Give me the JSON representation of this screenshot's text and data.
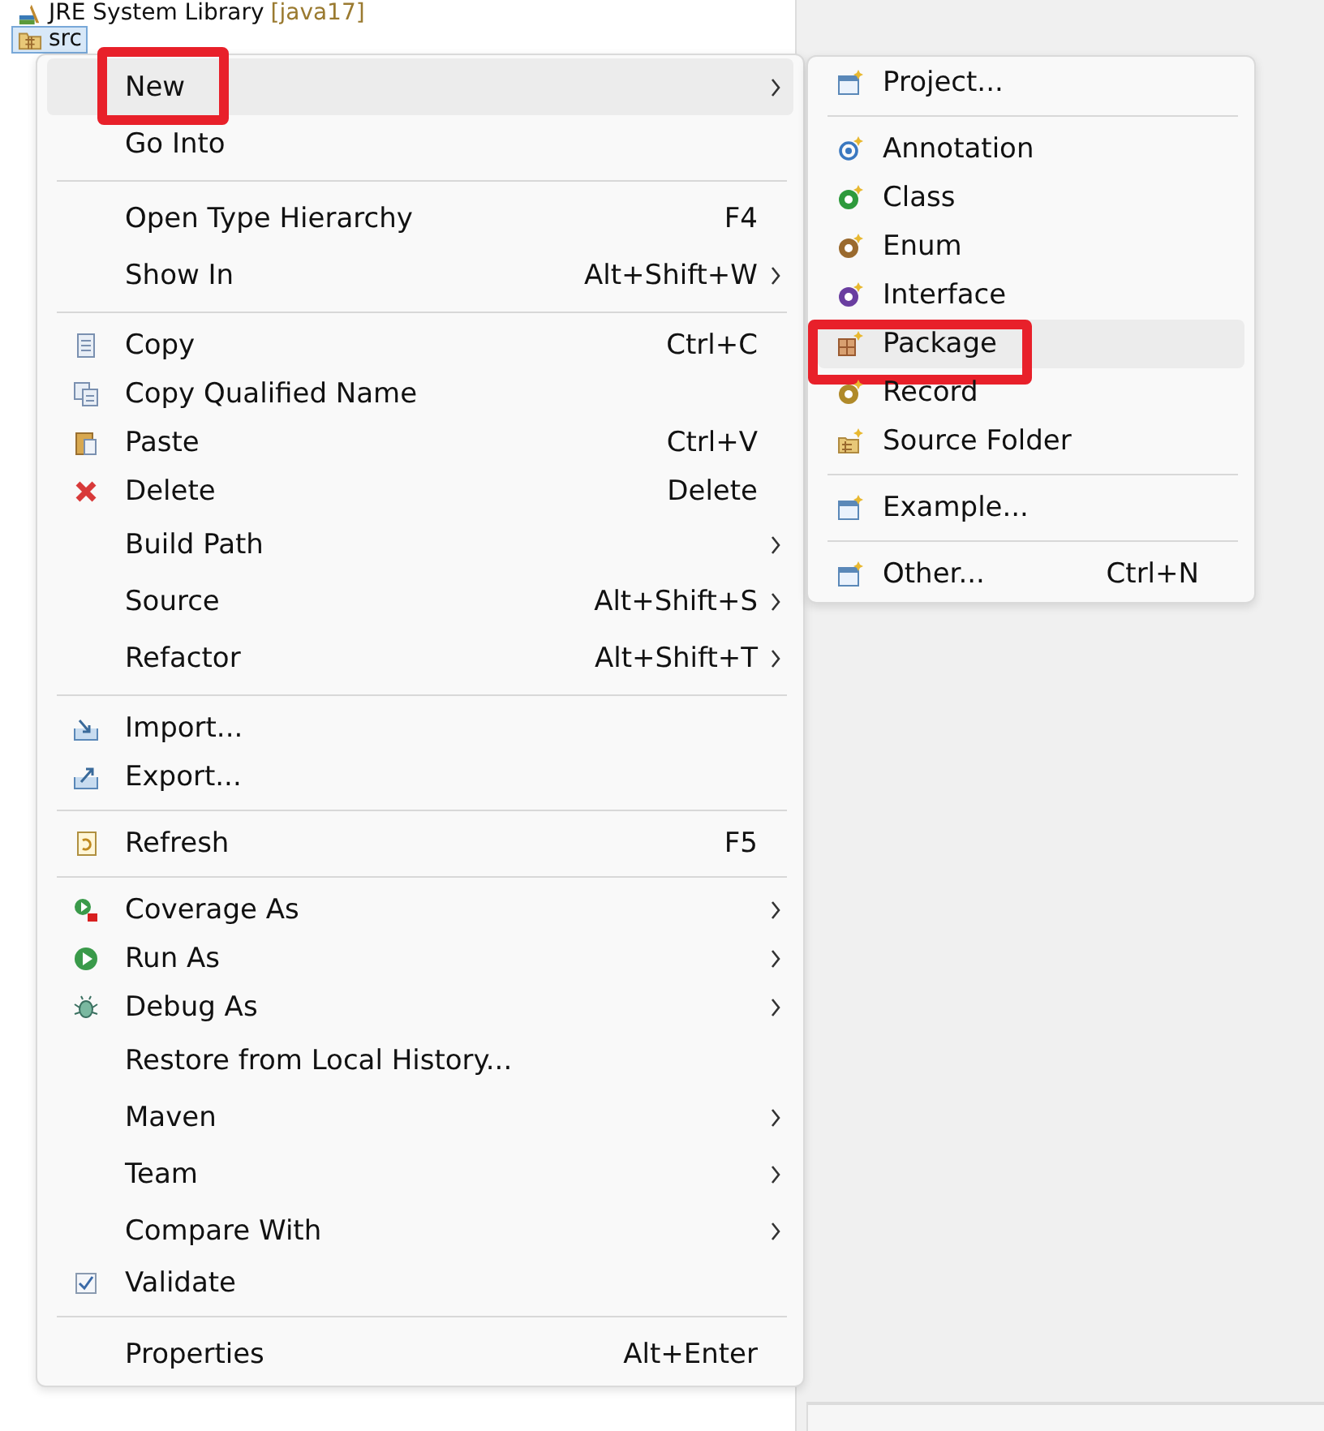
{
  "tree": [
    {
      "label": "JRE System Library",
      "decoration": "[java17]",
      "selected": false
    },
    {
      "label": "src",
      "selected": true
    }
  ],
  "context_menu": {
    "groups": [
      [
        {
          "label": "New",
          "submenu": true,
          "selected": true,
          "annotated": true
        },
        {
          "label": "Go Into",
          "submenu": false,
          "selected": false,
          "annotated": false
        }
      ],
      [
        {
          "label": "Open Type Hierarchy",
          "shortcut": "F4",
          "submenu": false,
          "selected": false,
          "annotated": false
        },
        {
          "label": "Show In",
          "shortcut": "Alt+Shift+W",
          "submenu": true,
          "selected": false,
          "annotated": false
        }
      ],
      [
        {
          "label": "Copy",
          "shortcut": "Ctrl+C",
          "submenu": false,
          "selected": false,
          "annotated": false
        },
        {
          "label": "Copy Qualified Name",
          "submenu": false,
          "selected": false,
          "annotated": false
        },
        {
          "label": "Paste",
          "shortcut": "Ctrl+V",
          "submenu": false,
          "selected": false,
          "annotated": false
        },
        {
          "label": "Delete",
          "shortcut": "Delete",
          "submenu": false,
          "selected": false,
          "annotated": false
        },
        {
          "label": "Build Path",
          "submenu": true,
          "selected": false,
          "annotated": false
        },
        {
          "label": "Source",
          "shortcut": "Alt+Shift+S",
          "submenu": true,
          "selected": false,
          "annotated": false
        },
        {
          "label": "Refactor",
          "shortcut": "Alt+Shift+T",
          "submenu": true,
          "selected": false,
          "annotated": false
        }
      ],
      [
        {
          "label": "Import...",
          "submenu": false,
          "selected": false,
          "annotated": false
        },
        {
          "label": "Export...",
          "submenu": false,
          "selected": false,
          "annotated": false
        }
      ],
      [
        {
          "label": "Refresh",
          "shortcut": "F5",
          "submenu": false,
          "selected": false,
          "annotated": false
        }
      ],
      [
        {
          "label": "Coverage As",
          "submenu": true,
          "selected": false,
          "annotated": false
        },
        {
          "label": "Run As",
          "submenu": true,
          "selected": false,
          "annotated": false
        },
        {
          "label": "Debug As",
          "submenu": true,
          "selected": false,
          "annotated": false
        },
        {
          "label": "Restore from Local History...",
          "submenu": false,
          "selected": false,
          "annotated": false
        },
        {
          "label": "Maven",
          "submenu": true,
          "selected": false,
          "annotated": false
        },
        {
          "label": "Team",
          "submenu": true,
          "selected": false,
          "annotated": false
        },
        {
          "label": "Compare With",
          "submenu": true,
          "selected": false,
          "annotated": false
        },
        {
          "label": "Validate",
          "submenu": false,
          "selected": false,
          "annotated": false
        }
      ],
      [
        {
          "label": "Properties",
          "shortcut": "Alt+Enter",
          "submenu": false,
          "selected": false,
          "annotated": false
        }
      ]
    ]
  },
  "submenu": {
    "groups": [
      [
        {
          "label": "Project...",
          "selected": false,
          "annotated": false
        }
      ],
      [
        {
          "label": "Annotation",
          "selected": false,
          "annotated": false
        },
        {
          "label": "Class",
          "selected": false,
          "annotated": false
        },
        {
          "label": "Enum",
          "selected": false,
          "annotated": false
        },
        {
          "label": "Interface",
          "selected": false,
          "annotated": false
        },
        {
          "label": "Package",
          "selected": true,
          "annotated": true
        },
        {
          "label": "Record",
          "selected": false,
          "annotated": false
        },
        {
          "label": "Source Folder",
          "selected": false,
          "annotated": false
        }
      ],
      [
        {
          "label": "Example...",
          "selected": false,
          "annotated": false
        }
      ],
      [
        {
          "label": "Other...",
          "shortcut": "Ctrl+N",
          "selected": false,
          "annotated": false
        }
      ]
    ]
  }
}
